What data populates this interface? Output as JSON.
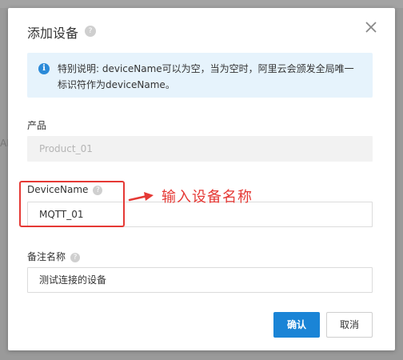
{
  "background": {
    "left_text": "AD"
  },
  "dialog": {
    "title": "添加设备",
    "help_glyph": "?",
    "info_glyph": "i",
    "info_text": "特别说明: deviceName可以为空，当为空时，阿里云会颁发全局唯一标识符作为deviceName。"
  },
  "form": {
    "product_label": "产品",
    "product_value": "Product_01",
    "devicename_label": "DeviceName",
    "devicename_value": "MQTT_01",
    "remark_label": "备注名称",
    "remark_value": "测试连接的设备"
  },
  "annotation": {
    "text": "输入设备名称",
    "color": "#e53935"
  },
  "buttons": {
    "confirm": "确认",
    "cancel": "取消"
  },
  "colors": {
    "primary": "#1a84d6",
    "info_bg": "#e6f3fc",
    "info_icon": "#2b8ad8"
  }
}
